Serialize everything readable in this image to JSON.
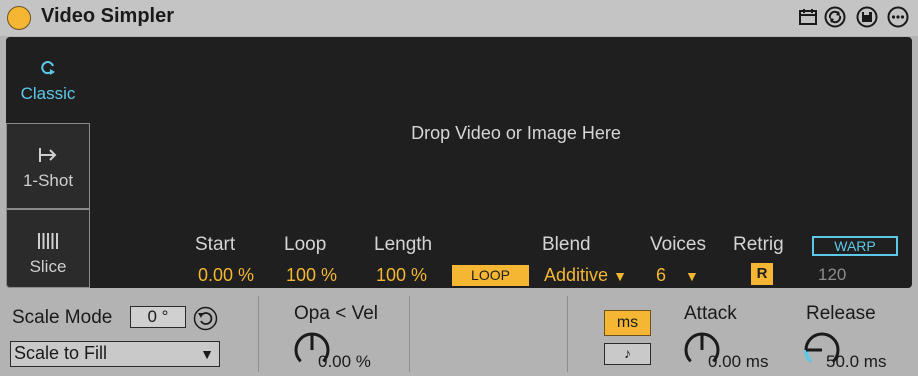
{
  "window": {
    "title": "Video Simpler"
  },
  "modes": [
    {
      "label": "Classic",
      "icon": "loop-icon"
    },
    {
      "label": "1-Shot",
      "icon": "one-shot-icon"
    },
    {
      "label": "Slice",
      "icon": "slice-icon"
    }
  ],
  "drop_hint": "Drop Video or Image Here",
  "params": {
    "start": {
      "label": "Start",
      "value": "0.00 %"
    },
    "loop": {
      "label": "Loop",
      "value": "100 %"
    },
    "length": {
      "label": "Length",
      "value": "100 %"
    },
    "loop_button": "LOOP",
    "blend": {
      "label": "Blend",
      "value": "Additive"
    },
    "voices": {
      "label": "Voices",
      "value": "6"
    },
    "retrig": {
      "label": "Retrig",
      "value": "R"
    },
    "warp_button": "WARP",
    "tempo": "120"
  },
  "bottom": {
    "scale_mode_label": "Scale Mode",
    "scale_degrees": "0 °",
    "scale_option": "Scale to Fill",
    "opa_vel": {
      "label": "Opa < Vel",
      "value": "0.00 %",
      "level": 0.0
    },
    "ms_button": "ms",
    "sync_button": "♪",
    "attack": {
      "label": "Attack",
      "value": "0.00 ms",
      "level": 0.0
    },
    "release": {
      "label": "Release",
      "value": "50.0 ms",
      "level": 0.25
    }
  },
  "colors": {
    "accent": "#f5b733",
    "highlight": "#5ec8e8",
    "panel": "#1f1f1f",
    "chrome": "#b3b3b3"
  }
}
